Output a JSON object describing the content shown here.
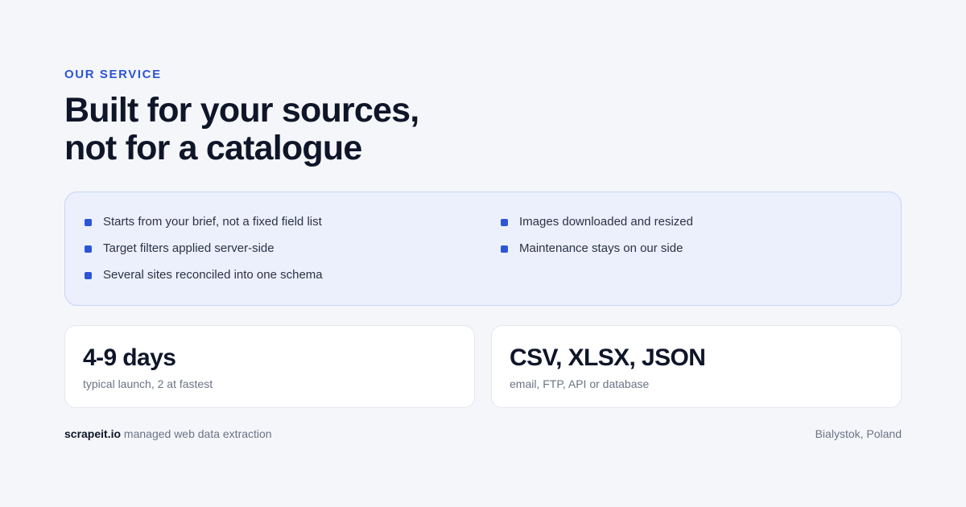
{
  "eyebrow": "OUR SERVICE",
  "headline": {
    "line1": "Built for your sources,",
    "line2": "not for a catalogue"
  },
  "features": {
    "left": [
      "Starts from your brief, not a fixed field list",
      "Target filters applied server-side",
      "Several sites reconciled into one schema"
    ],
    "right": [
      "Images downloaded and resized",
      "Maintenance stays on our side"
    ]
  },
  "stats": [
    {
      "value": "4-9 days",
      "caption": "typical launch, 2 at fastest"
    },
    {
      "value": "CSV, XLSX, JSON",
      "caption": "email, FTP, API or database"
    }
  ],
  "footer": {
    "brand": "scrapeit.io",
    "tagline": "managed web data extraction",
    "location": "Bialystok, Poland"
  },
  "colors": {
    "accent": "#2d55d6",
    "background": "#f5f6fa",
    "feature_panel": "#ebf0fc",
    "heading": "#0f1629",
    "muted": "#6b7385"
  },
  "icons": {
    "bullet": "square-bullet-icon"
  }
}
